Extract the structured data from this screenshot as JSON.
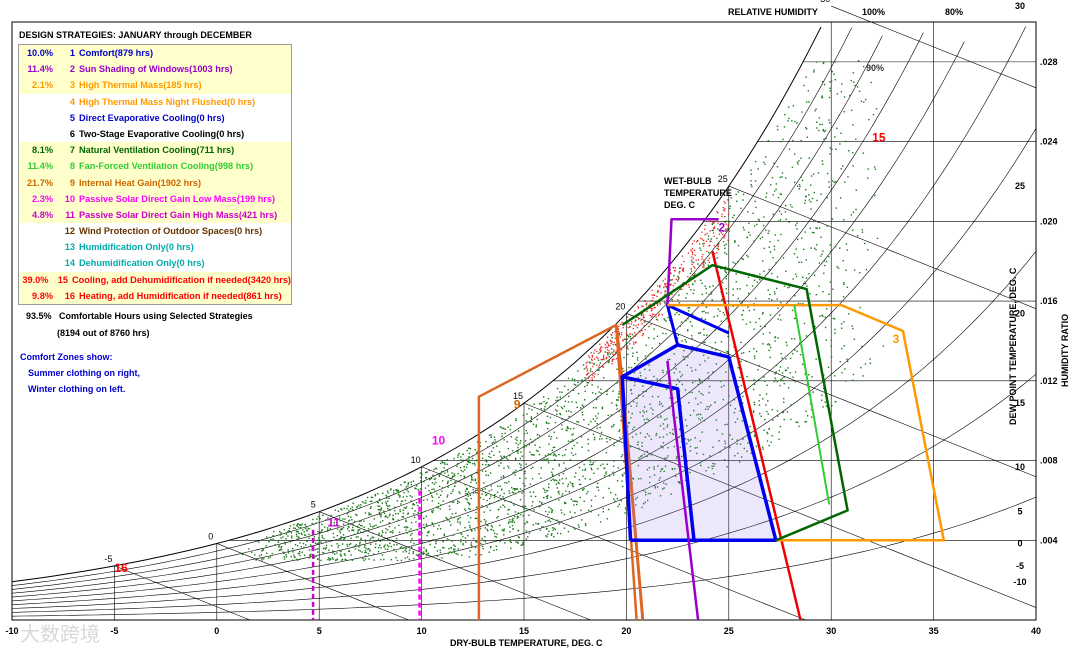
{
  "header": {
    "title": "DESIGN STRATEGIES:  JANUARY through DECEMBER",
    "relative_humidity_label": "RELATIVE HUMIDITY",
    "rh_100": "100%",
    "rh_80": "80%"
  },
  "legend_items": [
    {
      "pct": "10.0%",
      "num": "1",
      "label": "Comfort(879 hrs)",
      "color": "#0000cc",
      "highlight": true
    },
    {
      "pct": "11.4%",
      "num": "2",
      "label": "Sun Shading of Windows(1003 hrs)",
      "color": "#9900cc",
      "highlight": true
    },
    {
      "pct": "2.1%",
      "num": "3",
      "label": "High Thermal Mass(185 hrs)",
      "color": "#ff9900",
      "highlight": true
    },
    {
      "pct": "",
      "num": "4",
      "label": "High Thermal Mass Night Flushed(0 hrs)",
      "color": "#ff9900",
      "highlight": false
    },
    {
      "pct": "",
      "num": "5",
      "label": "Direct Evaporative Cooling(0 hrs)",
      "color": "#0000cc",
      "highlight": false
    },
    {
      "pct": "",
      "num": "6",
      "label": "Two-Stage Evaporative Cooling(0 hrs)",
      "color": "#000000",
      "highlight": false
    },
    {
      "pct": "8.1%",
      "num": "7",
      "label": "Natural Ventilation Cooling(711 hrs)",
      "color": "#006600",
      "highlight": true
    },
    {
      "pct": "11.4%",
      "num": "8",
      "label": "Fan-Forced Ventilation Cooling(998 hrs)",
      "color": "#33cc33",
      "highlight": true
    },
    {
      "pct": "21.7%",
      "num": "9",
      "label": "Internal Heat Gain(1902 hrs)",
      "color": "#cc6600",
      "highlight": true
    },
    {
      "pct": "2.3%",
      "num": "10",
      "label": "Passive Solar Direct Gain Low Mass(199 hrs)",
      "color": "#ff00ff",
      "highlight": true
    },
    {
      "pct": "4.8%",
      "num": "11",
      "label": "Passive Solar Direct Gain High Mass(421 hrs)",
      "color": "#cc00cc",
      "highlight": true
    },
    {
      "pct": "",
      "num": "12",
      "label": "Wind Protection of Outdoor Spaces(0 hrs)",
      "color": "#663300",
      "highlight": false
    },
    {
      "pct": "",
      "num": "13",
      "label": "Humidification Only(0 hrs)",
      "color": "#00aaaa",
      "highlight": false
    },
    {
      "pct": "",
      "num": "14",
      "label": "Dehumidification Only(0 hrs)",
      "color": "#00aaaa",
      "highlight": false
    },
    {
      "pct": "39.0%",
      "num": "15",
      "label": "Cooling, add Dehumidification if needed(3420 hrs)",
      "color": "#ff0000",
      "highlight": true
    },
    {
      "pct": "9.8%",
      "num": "16",
      "label": "Heating, add Humidification if needed(861 hrs)",
      "color": "#ff0000",
      "highlight": true
    }
  ],
  "summary": {
    "pct": "93.5%",
    "text": "Comfortable Hours using Selected Strategies",
    "detail": "(8194 out of 8760 hrs)"
  },
  "notes": {
    "line1": "Comfort Zones show:",
    "line2": "Summer clothing on right,",
    "line3": "Winter clothing on left."
  },
  "labels": {
    "wet_bulb_1": "WET-BULB",
    "wet_bulb_2": "TEMPERATURE",
    "wet_bulb_3": "DEG. C",
    "dew_point": "DEW POINT TEMPERATURE, DEG. C",
    "humidity_ratio": "HUMIDITY RATIO",
    "rh_90": "90%",
    "watermark": "大数跨境"
  },
  "chart_data": {
    "type": "scatter",
    "xlabel": "DRY-BULB TEMPERATURE, DEG. C",
    "ylabel": "HUMIDITY RATIO",
    "x_ticks": [
      "-10",
      "-5",
      "0",
      "5",
      "10",
      "15",
      "20",
      "25",
      "30",
      "35",
      "40"
    ],
    "xlim": [
      -10,
      40
    ],
    "ylim": [
      0,
      0.03
    ],
    "humidity_ratio_ticks": [
      ".004",
      ".008",
      ".012",
      ".016",
      ".020",
      ".024",
      ".028"
    ],
    "dew_point_ticks": [
      "30",
      "25",
      "20",
      "15",
      "10",
      "5",
      "0",
      "-5",
      "-10"
    ],
    "wet_bulb_ticks": [
      "-5",
      "0",
      "5",
      "10",
      "15",
      "20",
      "25",
      "30"
    ],
    "zone_labels": [
      "2",
      "3",
      "9",
      "10",
      "11",
      "15",
      "16"
    ],
    "colors": {
      "points": "#1a7a1a",
      "comfort": "#0000ee",
      "sun_shading": "#9900cc",
      "thermal_mass": "#ff9900",
      "natural_ventilation": "#006600",
      "fan_ventilation": "#33cc33",
      "internal_heat": "#dd6622",
      "passive_low": "#ff00ff",
      "passive_high": "#cc00cc",
      "cooling": "#ee0000"
    }
  }
}
